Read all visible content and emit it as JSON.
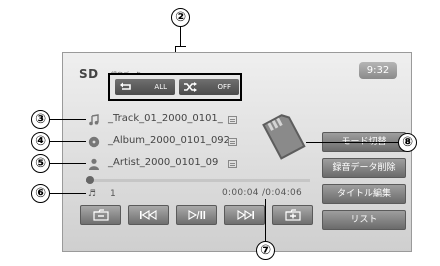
{
  "screen": {
    "source_label": "SD",
    "source_sub": "録音データ",
    "clock": "9:32"
  },
  "mode": {
    "repeat_value": "ALL",
    "shuffle_value": "OFF"
  },
  "info": {
    "track": "_Track_01_2000_0101_",
    "album": "_Album_2000_0101_092",
    "artist": "_Artist_2000_0101_09"
  },
  "playback": {
    "track_number": "1",
    "time_display": "0:00:04 /0:04:06",
    "elapsed_fraction": 0.016
  },
  "side_buttons": [
    {
      "label": "モード切替"
    },
    {
      "label": "録音データ削除"
    },
    {
      "label": "タイトル編集"
    },
    {
      "label": "リスト"
    }
  ],
  "callouts": {
    "c2": "②",
    "c3": "③",
    "c4": "④",
    "c5": "⑤",
    "c6": "⑥",
    "c7": "⑦",
    "c8": "⑧"
  },
  "colors": {
    "button_dark": "#5a5a5a",
    "screen_bg": "#e2e2e2"
  }
}
